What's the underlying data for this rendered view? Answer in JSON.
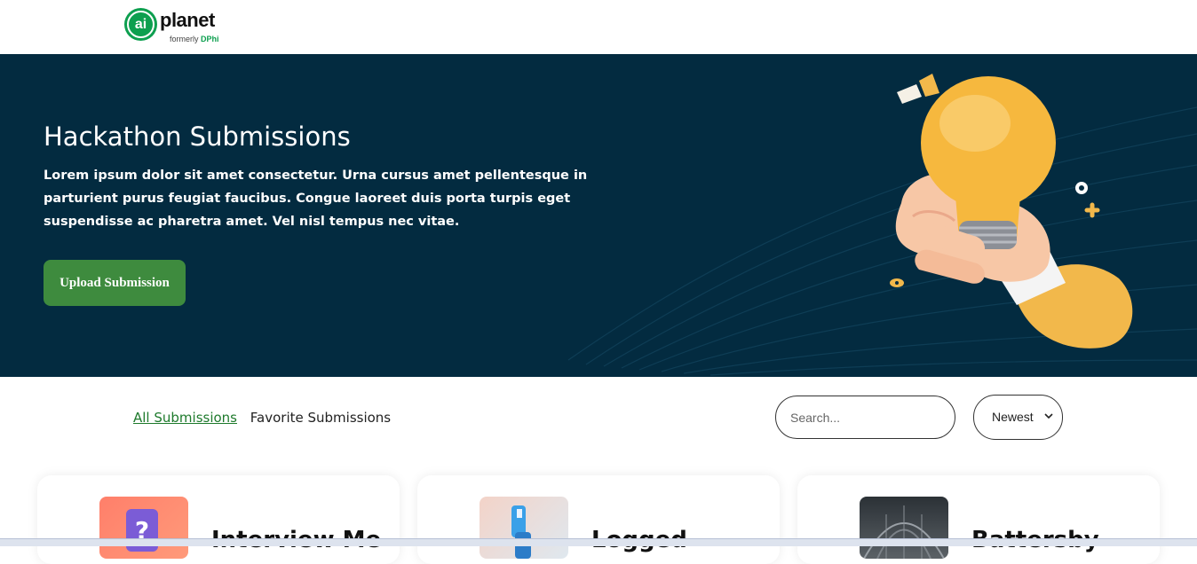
{
  "brand": {
    "logo_mark": "ai",
    "logo_word": "planet",
    "tagline_prefix": "formerly ",
    "tagline_brand": "DPhi",
    "color": "#0d9f4f"
  },
  "hero": {
    "title": "Hackathon Submissions",
    "description": "Lorem ipsum dolor sit amet consectetur. Urna cursus amet pellentesque in parturient purus feugiat faucibus. Congue laoreet duis porta turpis eget suspendisse ac pharetra amet. Vel nisl tempus nec vitae.",
    "upload_label": "Upload Submission",
    "bg_color": "#032b40",
    "button_color": "#3e8b3e",
    "illustration_icon": "hand-holding-lightbulb-icon"
  },
  "tabs": {
    "all_label": "All Submissions",
    "favorite_label": "Favorite Submissions",
    "active": "All Submissions"
  },
  "search": {
    "placeholder": "Search..."
  },
  "sort": {
    "selected": "Newest",
    "icon": "chevron-down-icon"
  },
  "cards": [
    {
      "title": "Interview Me",
      "thumb_icon": "question-mark-icon"
    },
    {
      "title": "Logged",
      "thumb_icon": "robot-icon"
    },
    {
      "title": "Battersby",
      "thumb_icon": "station-photo-icon"
    }
  ]
}
